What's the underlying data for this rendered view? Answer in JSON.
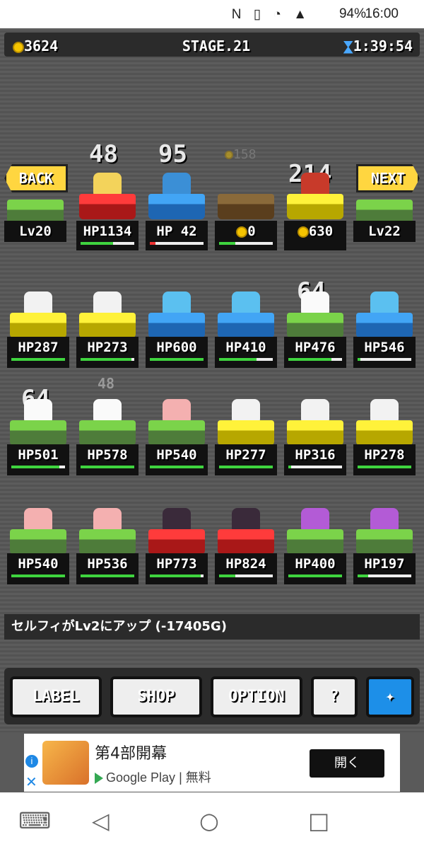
{
  "statusbar": {
    "battery": "94%",
    "time": "16:00"
  },
  "topbar": {
    "gold": "3624",
    "stage": "STAGE.21",
    "timer": "1:39:54"
  },
  "nav_signs": {
    "back": "BACK",
    "back_level": "Lv20",
    "next": "NEXT",
    "next_level": "Lv22"
  },
  "row0": [
    {
      "hp": "HP1134",
      "dmg": "48"
    },
    {
      "hp": "HP 42",
      "dmg": "95"
    },
    {
      "value": "0",
      "ghost": "158"
    },
    {
      "value": "630",
      "dmg": "214"
    }
  ],
  "rows": [
    [
      "HP287",
      "HP273",
      "HP600",
      "HP410",
      "HP476",
      "HP546"
    ],
    [
      "HP501",
      "HP578",
      "HP540",
      "HP277",
      "HP316",
      "HP278"
    ],
    [
      "HP540",
      "HP536",
      "HP773",
      "HP824",
      "HP400",
      "HP197"
    ]
  ],
  "row_dmg": {
    "r1c4": "64",
    "r2c0": "64",
    "r2c1": "48"
  },
  "message": "セルフィがLv2にアップ (-17405G)",
  "menu": {
    "label": "LABEL",
    "shop": "SHOP",
    "option": "OPTION",
    "help": "?"
  },
  "ad": {
    "title": "第4部開幕",
    "store": "Google Play",
    "price": "| 無料",
    "cta": "開く",
    "info": "i",
    "close": "✕"
  },
  "colors": {
    "bg": "#5a5a5a",
    "panel": "#2b2b2b",
    "hp_bar": "#3fd43f",
    "twitter": "#1d8fe8"
  }
}
